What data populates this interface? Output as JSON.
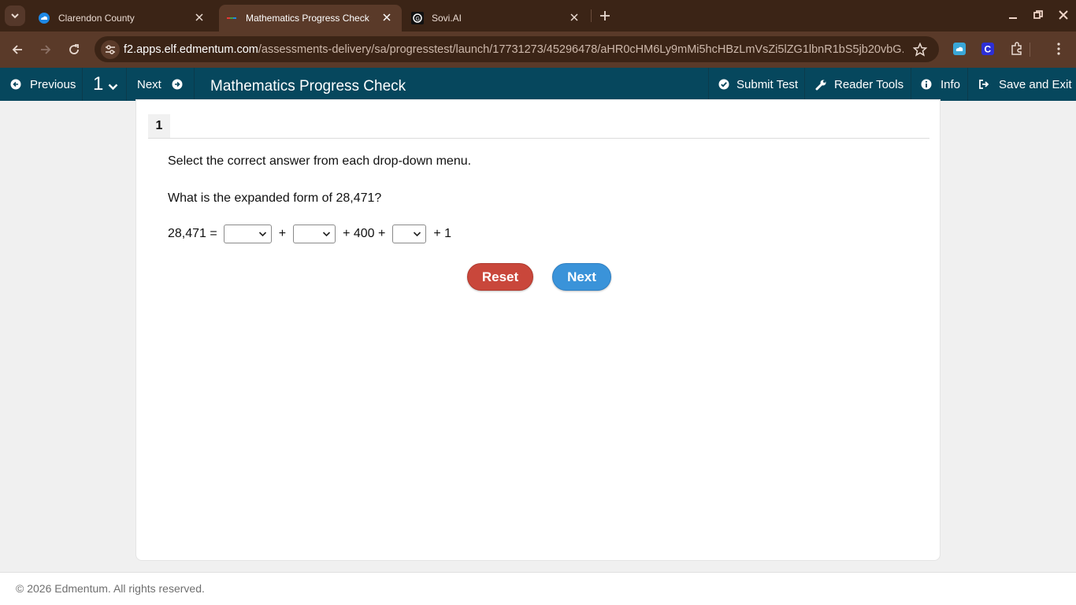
{
  "browser": {
    "tabs": [
      {
        "label": "Clarendon County"
      },
      {
        "label": "Mathematics Progress Check"
      },
      {
        "label": "Sovi.AI"
      }
    ],
    "url_host": "f2.apps.elf.edmentum.com",
    "url_path": "/assessments-delivery/sa/progresstest/launch/17731273/45296478/aHR0cHM6Ly9mMi5hcHBzLmVsZi5lZG1lbnR1bS5jb20vbG..."
  },
  "header": {
    "previous": "Previous",
    "question_number": "1",
    "next": "Next",
    "title": "Mathematics Progress Check",
    "submit": "Submit Test",
    "reader_tools": "Reader Tools",
    "info": "Info",
    "save_exit": "Save and Exit"
  },
  "question": {
    "tab_number": "1",
    "instruction": "Select the correct answer from each drop-down menu.",
    "prompt": "What is the expanded form of 28,471?",
    "equation": {
      "lhs": "28,471 =",
      "plus1": "+",
      "mid": "+ 400 +",
      "tail": "+ 1"
    }
  },
  "buttons": {
    "reset": "Reset",
    "next": "Next"
  },
  "footer": {
    "copyright": "© 2026 Edmentum. All rights reserved."
  }
}
